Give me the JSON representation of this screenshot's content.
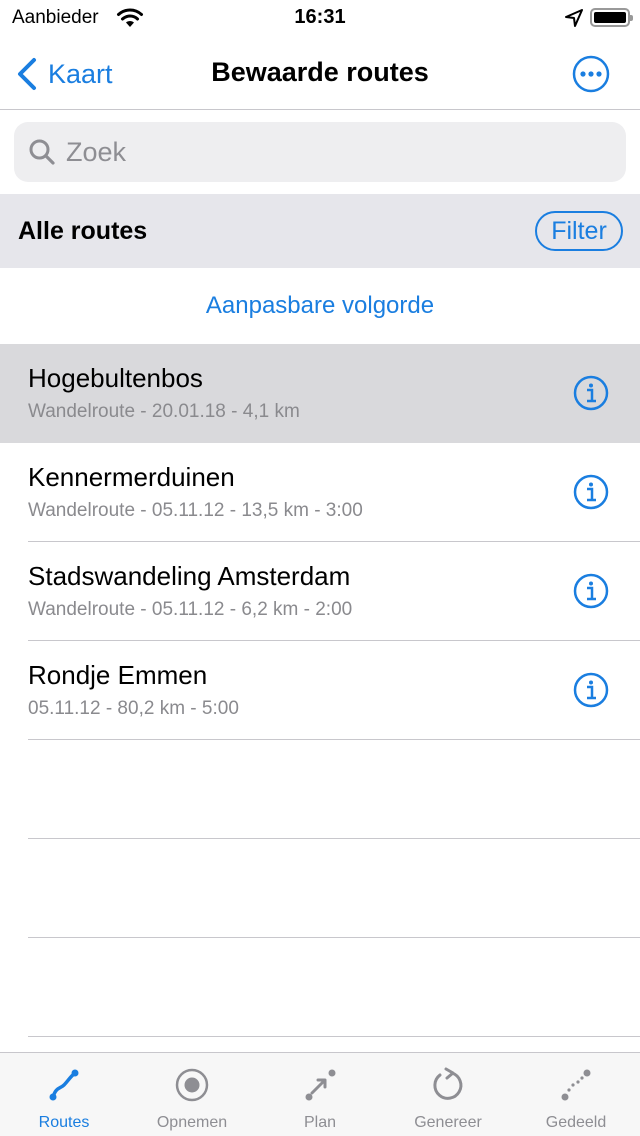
{
  "status_bar": {
    "carrier": "Aanbieder",
    "time": "16:31"
  },
  "nav": {
    "back_label": "Kaart",
    "title": "Bewaarde routes",
    "more_icon": "ellipsis-circle-icon"
  },
  "search": {
    "placeholder": "Zoek",
    "value": ""
  },
  "section": {
    "title": "Alle routes",
    "filter_label": "Filter"
  },
  "order": {
    "label": "Aanpasbare volgorde"
  },
  "routes": [
    {
      "name": "Hogebultenbos",
      "meta": "Wandelroute - 20.01.18 - 4,1 km",
      "selected": true
    },
    {
      "name": "Kennermerduinen",
      "meta": "Wandelroute - 05.11.12 - 13,5 km - 3:00",
      "selected": false
    },
    {
      "name": "Stadswandeling Amsterdam",
      "meta": "Wandelroute - 05.11.12 - 6,2 km - 2:00",
      "selected": false
    },
    {
      "name": "Rondje Emmen",
      "meta": "05.11.12 - 80,2 km - 5:00",
      "selected": false
    }
  ],
  "tabs": [
    {
      "label": "Routes",
      "icon": "route-icon",
      "active": true
    },
    {
      "label": "Opnemen",
      "icon": "record-icon",
      "active": false
    },
    {
      "label": "Plan",
      "icon": "plan-icon",
      "active": false
    },
    {
      "label": "Genereer",
      "icon": "generate-icon",
      "active": false
    },
    {
      "label": "Gedeeld",
      "icon": "shared-icon",
      "active": false
    }
  ],
  "colors": {
    "accent": "#1a7ee0",
    "selected_row": "#d9d9dc",
    "section_bg": "#e6e6eb"
  }
}
